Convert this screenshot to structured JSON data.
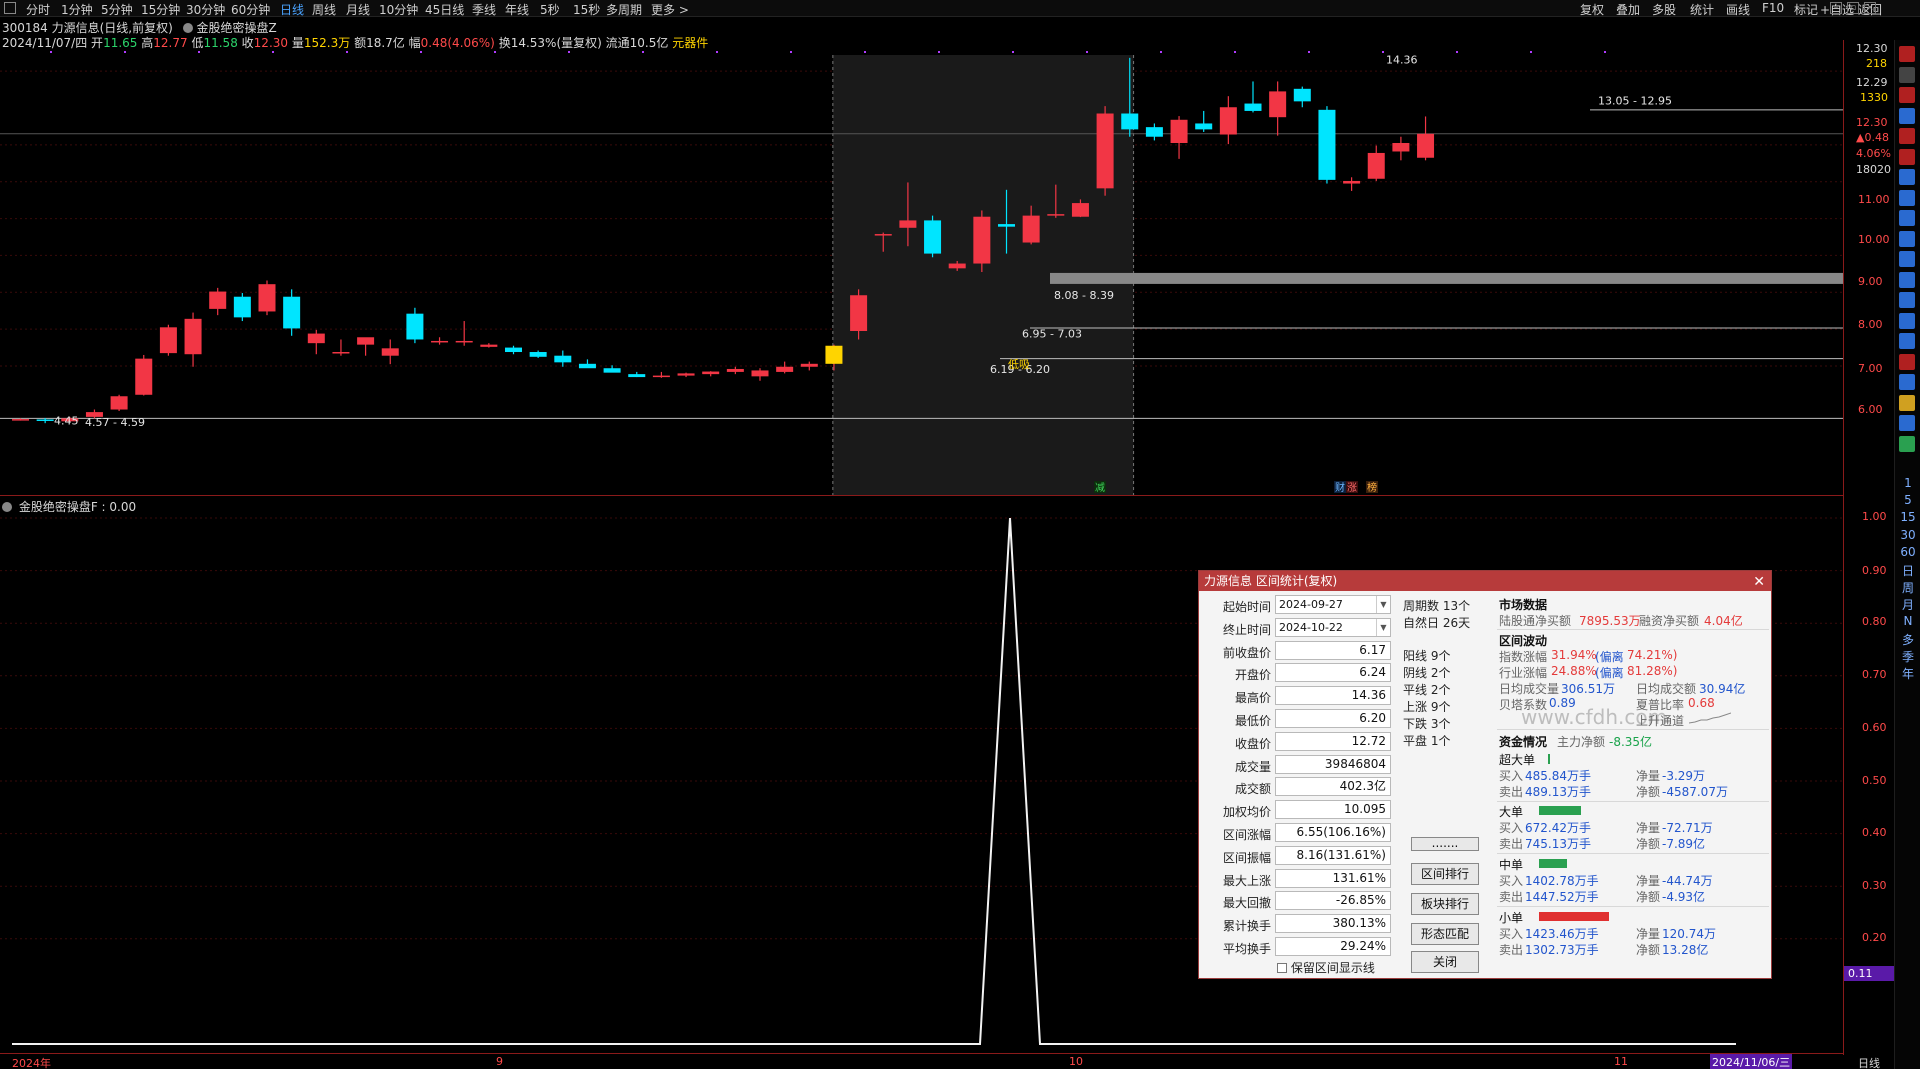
{
  "top_bar": {
    "periods": [
      "分时",
      "1分钟",
      "5分钟",
      "15分钟",
      "30分钟",
      "60分钟",
      "日线",
      "周线",
      "月线",
      "10分钟",
      "45日线",
      "季线",
      "年线",
      "5秒",
      "15秒",
      "多周期",
      "更多 >"
    ],
    "active_period": "日线",
    "tools": [
      "复权",
      "叠加",
      "多股",
      "统计",
      "画线",
      "F10",
      "标记",
      "+自选",
      "返回"
    ]
  },
  "stock": {
    "title_line": "300184 力源信息(日线,前复权)",
    "indicator_name": "金股绝密操盘Z",
    "date": "2024/11/07/四",
    "open_label": "开",
    "open": "11.65",
    "high_label": "高",
    "high": "12.77",
    "low_label": "低",
    "low": "11.58",
    "close_label": "收",
    "close": "12.30",
    "vol_label": "量",
    "vol": "152.3万",
    "amount_label": "额",
    "amount": "18.7亿",
    "change_label": "幅",
    "change": "0.48(4.06%)",
    "turnover": "换14.53%(量复权)",
    "float": "流通10.5亿",
    "component": "元器件"
  },
  "right_axis": {
    "top_value": "12.30",
    "top_count": "218",
    "value2": "12.29",
    "count2": "1330",
    "last_price": "12.30",
    "last_change": "▲0.48",
    "last_pct": "4.06%",
    "last_vol": "18020",
    "ticks": [
      "11.00",
      "10.00",
      "9.00",
      "8.00",
      "7.00",
      "6.00"
    ],
    "sub_ticks": [
      "1.00",
      "0.90",
      "0.80",
      "0.70",
      "0.60",
      "0.50",
      "0.40",
      "0.30",
      "0.20"
    ],
    "sub_current": "0.11"
  },
  "main_labels": {
    "range1": "4.57 - 4.59",
    "low_mark": "4.45",
    "range2": "6.19 - 6.20",
    "range3": "6.95 - 7.03",
    "range4": "8.08 - 8.39",
    "range5": "13.05 - 12.95",
    "peak": "14.36",
    "signal": "低吸",
    "badge1": "减",
    "badge2": "财",
    "badge3": "涨",
    "badge4": "榜"
  },
  "sub_indicator": {
    "label": "金股绝密操盘F : 0.00"
  },
  "dates": {
    "d1": "2024年",
    "d2": "9",
    "d3": "10",
    "d4": "11",
    "cur": "2024/11/06/三",
    "period": "日线"
  },
  "side_icons": [
    "cross-icon",
    "list-icon",
    "bars-icon",
    "grid-icon",
    "chart-icon",
    "chart-icon",
    "doc-icon",
    "doc-icon",
    "fa-icon",
    "doc-icon",
    "doc-icon",
    "frz-icon",
    "doc-icon",
    "ring-icon",
    "rsi-icon",
    "dollar-icon",
    "move-icon",
    "pen-icon",
    "fs-icon",
    "photo-icon"
  ],
  "side_chars": [
    "1",
    "5",
    "15",
    "30",
    "60",
    "日",
    "周",
    "月",
    "N",
    "多",
    "季",
    "年"
  ],
  "chart_data": {
    "type": "candlestick",
    "ylim": [
      4.4,
      14.6
    ],
    "candles": [
      {
        "o": 4.55,
        "h": 4.58,
        "l": 4.52,
        "c": 4.56
      },
      {
        "o": 4.55,
        "h": 4.59,
        "l": 4.45,
        "c": 4.52
      },
      {
        "o": 4.5,
        "h": 4.62,
        "l": 4.48,
        "c": 4.58
      },
      {
        "o": 4.62,
        "h": 4.82,
        "l": 4.58,
        "c": 4.75
      },
      {
        "o": 4.82,
        "h": 5.22,
        "l": 4.78,
        "c": 5.18
      },
      {
        "o": 5.22,
        "h": 6.3,
        "l": 5.2,
        "c": 6.2
      },
      {
        "o": 6.35,
        "h": 7.12,
        "l": 6.28,
        "c": 7.05
      },
      {
        "o": 6.32,
        "h": 7.45,
        "l": 5.98,
        "c": 7.28
      },
      {
        "o": 7.55,
        "h": 8.12,
        "l": 7.38,
        "c": 8.02
      },
      {
        "o": 7.88,
        "h": 7.98,
        "l": 7.22,
        "c": 7.32
      },
      {
        "o": 7.48,
        "h": 8.32,
        "l": 7.38,
        "c": 8.22
      },
      {
        "o": 7.88,
        "h": 8.08,
        "l": 6.82,
        "c": 7.02
      },
      {
        "o": 6.62,
        "h": 6.98,
        "l": 6.32,
        "c": 6.88
      },
      {
        "o": 6.38,
        "h": 6.72,
        "l": 6.28,
        "c": 6.38
      },
      {
        "o": 6.58,
        "h": 6.68,
        "l": 6.28,
        "c": 6.78
      },
      {
        "o": 6.28,
        "h": 6.72,
        "l": 6.05,
        "c": 6.48
      },
      {
        "o": 7.42,
        "h": 7.58,
        "l": 6.62,
        "c": 6.72
      },
      {
        "o": 6.68,
        "h": 6.78,
        "l": 6.58,
        "c": 6.68
      },
      {
        "o": 6.68,
        "h": 7.22,
        "l": 6.55,
        "c": 6.68
      },
      {
        "o": 6.52,
        "h": 6.62,
        "l": 6.5,
        "c": 6.58
      },
      {
        "o": 6.5,
        "h": 6.55,
        "l": 6.32,
        "c": 6.38
      },
      {
        "o": 6.38,
        "h": 6.42,
        "l": 6.22,
        "c": 6.25
      },
      {
        "o": 6.28,
        "h": 6.42,
        "l": 5.98,
        "c": 6.1
      },
      {
        "o": 6.06,
        "h": 6.18,
        "l": 6.0,
        "c": 5.94
      },
      {
        "o": 5.94,
        "h": 6.02,
        "l": 5.85,
        "c": 5.82
      },
      {
        "o": 5.78,
        "h": 5.84,
        "l": 5.7,
        "c": 5.7
      },
      {
        "o": 5.74,
        "h": 5.84,
        "l": 5.68,
        "c": 5.74
      },
      {
        "o": 5.74,
        "h": 5.82,
        "l": 5.7,
        "c": 5.8
      },
      {
        "o": 5.78,
        "h": 5.86,
        "l": 5.72,
        "c": 5.85
      },
      {
        "o": 5.84,
        "h": 5.98,
        "l": 5.78,
        "c": 5.92
      },
      {
        "o": 5.72,
        "h": 5.94,
        "l": 5.6,
        "c": 5.88
      },
      {
        "o": 5.84,
        "h": 6.12,
        "l": 5.8,
        "c": 5.98
      },
      {
        "o": 5.98,
        "h": 6.12,
        "l": 5.88,
        "c": 6.06
      },
      {
        "o": 6.06,
        "h": 6.58,
        "l": 5.88,
        "c": 6.55
      },
      {
        "o": 6.95,
        "h": 8.08,
        "l": 6.72,
        "c": 7.92
      },
      {
        "o": 9.58,
        "h": 9.62,
        "l": 9.1,
        "c": 9.58
      },
      {
        "o": 9.75,
        "h": 10.98,
        "l": 9.25,
        "c": 9.95
      },
      {
        "o": 9.95,
        "h": 10.08,
        "l": 8.95,
        "c": 9.05
      },
      {
        "o": 8.65,
        "h": 8.85,
        "l": 8.58,
        "c": 8.78
      },
      {
        "o": 8.78,
        "h": 10.22,
        "l": 8.55,
        "c": 10.05
      },
      {
        "o": 9.85,
        "h": 10.78,
        "l": 9.05,
        "c": 9.78
      },
      {
        "o": 9.35,
        "h": 10.35,
        "l": 9.3,
        "c": 10.08
      },
      {
        "o": 10.12,
        "h": 10.92,
        "l": 10.02,
        "c": 10.12
      },
      {
        "o": 10.05,
        "h": 10.52,
        "l": 10.04,
        "c": 10.42
      },
      {
        "o": 10.82,
        "h": 13.05,
        "l": 10.62,
        "c": 12.85
      },
      {
        "o": 12.85,
        "h": 14.36,
        "l": 12.22,
        "c": 12.42
      },
      {
        "o": 12.48,
        "h": 12.58,
        "l": 12.12,
        "c": 12.22
      },
      {
        "o": 12.05,
        "h": 12.78,
        "l": 11.62,
        "c": 12.68
      },
      {
        "o": 12.58,
        "h": 12.92,
        "l": 12.35,
        "c": 12.42
      },
      {
        "o": 12.28,
        "h": 13.32,
        "l": 12.02,
        "c": 13.02
      },
      {
        "o": 13.12,
        "h": 13.72,
        "l": 12.88,
        "c": 12.92
      },
      {
        "o": 12.75,
        "h": 13.72,
        "l": 12.25,
        "c": 13.45
      },
      {
        "o": 13.52,
        "h": 13.58,
        "l": 13.02,
        "c": 13.18
      },
      {
        "o": 12.95,
        "h": 13.05,
        "l": 10.95,
        "c": 11.05
      },
      {
        "o": 10.95,
        "h": 11.12,
        "l": 10.75,
        "c": 11.02
      },
      {
        "o": 11.08,
        "h": 11.98,
        "l": 11.02,
        "c": 11.78
      },
      {
        "o": 11.82,
        "h": 12.22,
        "l": 11.58,
        "c": 12.05
      },
      {
        "o": 11.65,
        "h": 12.77,
        "l": 11.58,
        "c": 12.3
      }
    ],
    "hlines": [
      4.58,
      6.2,
      7.03,
      8.39,
      12.95
    ],
    "sub_values": [
      0.0,
      1.0,
      0.0
    ],
    "sub_ylim": [
      0,
      1
    ]
  },
  "dialog": {
    "title": "力源信息 区间统计(复权)",
    "close": "✕",
    "fields": [
      {
        "label": "起始时间",
        "value": "2024-09-27"
      },
      {
        "label": "终止时间",
        "value": "2024-10-22"
      },
      {
        "label": "前收盘价",
        "value": "6.17"
      },
      {
        "label": "开盘价",
        "value": "6.24"
      },
      {
        "label": "最高价",
        "value": "14.36"
      },
      {
        "label": "最低价",
        "value": "6.20"
      },
      {
        "label": "收盘价",
        "value": "12.72"
      },
      {
        "label": "成交量",
        "value": "39846804"
      },
      {
        "label": "成交额",
        "value": "402.3亿"
      },
      {
        "label": "加权均价",
        "value": "10.095"
      },
      {
        "label": "区间涨幅",
        "value": "6.55(106.16%)"
      },
      {
        "label": "区间振幅",
        "value": "8.16(131.61%)"
      },
      {
        "label": "最大上涨",
        "value": "131.61%"
      },
      {
        "label": "最大回撤",
        "value": "-26.85%"
      },
      {
        "label": "累计换手",
        "value": "380.13%"
      },
      {
        "label": "平均换手",
        "value": "29.24%"
      }
    ],
    "checkbox": "保留区间显示线",
    "periods": "周期数 13个",
    "natural_days": "自然日 26天",
    "counts": [
      "阳线 9个",
      "阴线 2个",
      "平线 2个",
      "上涨 9个",
      "下跌 3个",
      "平盘 1个"
    ],
    "buttons": [
      ".......",
      "区间排行",
      "板块排行",
      "形态匹配",
      "关闭"
    ],
    "market_title": "市场数据",
    "north_label": "陆股通净买额",
    "north_value": "7895.53万",
    "margin_label": "融资净买额",
    "margin_value": "4.04亿",
    "range_title": "区间波动",
    "idx_label": "指数涨幅",
    "idx_value": "31.94%",
    "idx_dev_label": "(偏离",
    "idx_dev_value": "74.21%)",
    "ind_label": "行业涨幅",
    "ind_value": "24.88%",
    "ind_dev_label": "(偏离",
    "ind_dev_value": "81.28%)",
    "avg_vol_label": "日均成交量",
    "avg_vol_value": "306.51万",
    "avg_amt_label": "日均成交额",
    "avg_amt_value": "30.94亿",
    "beta_label": "贝塔系数",
    "beta_value": "0.89",
    "sharpe_label": "夏普比率",
    "sharpe_value": "0.68",
    "channel": "上升通道",
    "funds_title": "资金情况",
    "main_net_label": "主力净额",
    "main_net_value": "-8.35亿",
    "super": {
      "title": "超大单",
      "buy_label": "买入",
      "buy": "485.84万手",
      "sell_label": "卖出",
      "sell": "489.13万手",
      "net_vol_label": "净量",
      "net_vol": "-3.29万",
      "net_amt_label": "净额",
      "net_amt": "-4587.07万"
    },
    "large": {
      "title": "大单",
      "buy_label": "买入",
      "buy": "672.42万手",
      "sell_label": "卖出",
      "sell": "745.13万手",
      "net_vol_label": "净量",
      "net_vol": "-72.71万",
      "net_amt_label": "净额",
      "net_amt": "-7.89亿"
    },
    "medium": {
      "title": "中单",
      "buy_label": "买入",
      "buy": "1402.78万手",
      "sell_label": "卖出",
      "sell": "1447.52万手",
      "net_vol_label": "净量",
      "net_vol": "-44.74万",
      "net_amt_label": "净额",
      "net_amt": "-4.93亿"
    },
    "small": {
      "title": "小单",
      "buy_label": "买入",
      "buy": "1423.46万手",
      "sell_label": "卖出",
      "sell": "1302.73万手",
      "net_vol_label": "净量",
      "net_vol": "120.74万",
      "net_amt_label": "净额",
      "net_amt": "13.28亿"
    },
    "watermark": "www.cfdh.com"
  },
  "colors": {
    "up": "#f23645",
    "down": "#00e5ff",
    "accent": "#4aa3ff",
    "dialog_title": "#b73b3b"
  }
}
